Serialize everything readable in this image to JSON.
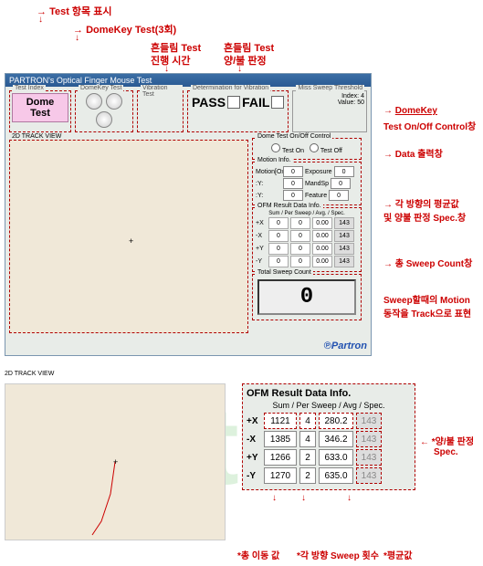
{
  "top_labels": {
    "test_index": "Test 항목 표시",
    "domekey": "DomeKey Test(3회)",
    "vib_test": "흔들림 Test",
    "vib_time": "진행 시간",
    "vib_test2": "흔들림 Test",
    "pass_fail": "양/불 판정"
  },
  "titlebar": "PARTRON's Optical Finger Mouse Test",
  "groups": {
    "test_index": "Test Index",
    "domekey_test": "DomeKey Test",
    "vibration_test": "Vibration Test",
    "determination": "Determination for Vibration",
    "miss_sweep": "Miss Sweep Threshold"
  },
  "dome_test_button": "Dome Test",
  "pass_label": "PASS",
  "fail_label": "FAIL",
  "miss_sweep": {
    "index_label": "Index:",
    "index_val": "4",
    "value_label": "Value:",
    "value_val": "50"
  },
  "track_view_label": "2D TRACK VIEW",
  "domekey_control": {
    "title": "Dome Test On/Off Control",
    "on": "Test On",
    "off": "Test Off"
  },
  "motion_info": {
    "title": "Motion Info.",
    "mx_label": "Motion[Ox",
    "mx_val": "Exposure",
    "y_label": ":Y:",
    "y_val": "0",
    "mandsp": "MandSp",
    "feature": "Feature",
    "zero": "0"
  },
  "ofm1": {
    "title": "OFM Result Data Info.",
    "header": "Sum / Per Sweep / Avg. / Spec.",
    "rows": [
      {
        "label": "+X",
        "sum": "0",
        "per": "0",
        "avg": "0.00",
        "spec": "143"
      },
      {
        "label": "-X",
        "sum": "0",
        "per": "0",
        "avg": "0.00",
        "spec": "143"
      },
      {
        "label": "+Y",
        "sum": "0",
        "per": "0",
        "avg": "0.00",
        "spec": "143"
      },
      {
        "label": "-Y",
        "sum": "0",
        "per": "0",
        "avg": "0.00",
        "spec": "143"
      }
    ]
  },
  "sweep_count": {
    "title": "Total Sweep Count",
    "value": "0"
  },
  "logo": "Partron",
  "callouts": {
    "domekey": "DomeKey",
    "onoff": "Test On/Off Control창",
    "data_out": "Data 출력창",
    "avg": "각 방향의 평균값",
    "spec": "및 양불 판정 Spec.창",
    "total_sweep": "총 Sweep Count창",
    "motion": "Sweep할때의 Motion",
    "track": "동작을 Track으로 표현"
  },
  "ofm2": {
    "title": "OFM Result Data Info.",
    "header": "Sum / Per Sweep / Avg / Spec.",
    "rows": [
      {
        "label": "+X",
        "sum": "1121",
        "per": "4",
        "avg": "280.2",
        "spec": "143"
      },
      {
        "label": "-X",
        "sum": "1385",
        "per": "4",
        "avg": "346.2",
        "spec": "143"
      },
      {
        "label": "+Y",
        "sum": "1266",
        "per": "2",
        "avg": "633.0",
        "spec": "143"
      },
      {
        "label": "-Y",
        "sum": "1270",
        "per": "2",
        "avg": "635.0",
        "spec": "143"
      }
    ]
  },
  "callouts2": {
    "spec": "*양/불 판정",
    "spec2": "Spec.",
    "sum": "*총 이동 값",
    "per": "*각 방향 Sweep 횟수",
    "avg": "*평균값"
  }
}
